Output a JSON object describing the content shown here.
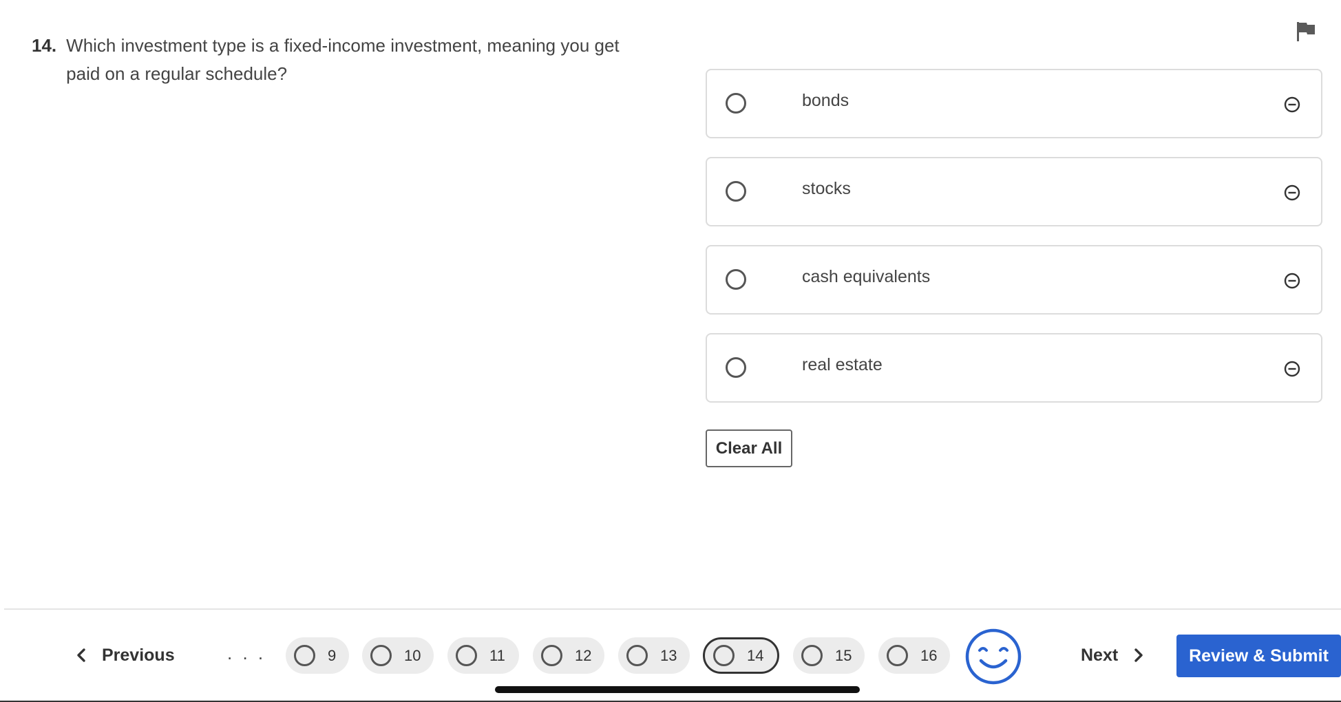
{
  "question": {
    "number": "14.",
    "text": "Which investment type is a fixed-income investment, meaning you get paid on a regular schedule?"
  },
  "options": [
    {
      "label": "bonds",
      "selected": false
    },
    {
      "label": "stocks",
      "selected": false
    },
    {
      "label": "cash equivalents",
      "selected": false
    },
    {
      "label": "real estate",
      "selected": false
    }
  ],
  "actions": {
    "clear_all": "Clear All"
  },
  "footer": {
    "previous_label": "Previous",
    "ellipsis": ". . .",
    "question_pills": [
      {
        "number": "9"
      },
      {
        "number": "10"
      },
      {
        "number": "11"
      },
      {
        "number": "12"
      },
      {
        "number": "13"
      },
      {
        "number": "14",
        "current": true
      },
      {
        "number": "15"
      },
      {
        "number": "16"
      }
    ],
    "next_label": "Next",
    "review_label": "Review & Submit"
  },
  "icons": {
    "flag": "flag-icon",
    "eliminate": "minus-circle-icon",
    "mood": "smiley-icon",
    "prev": "chevron-left-icon",
    "next": "chevron-right-icon"
  },
  "colors": {
    "accent": "#2a63d0",
    "text": "#333333",
    "border": "#dcdcdc",
    "pill_bg": "#ececec"
  }
}
